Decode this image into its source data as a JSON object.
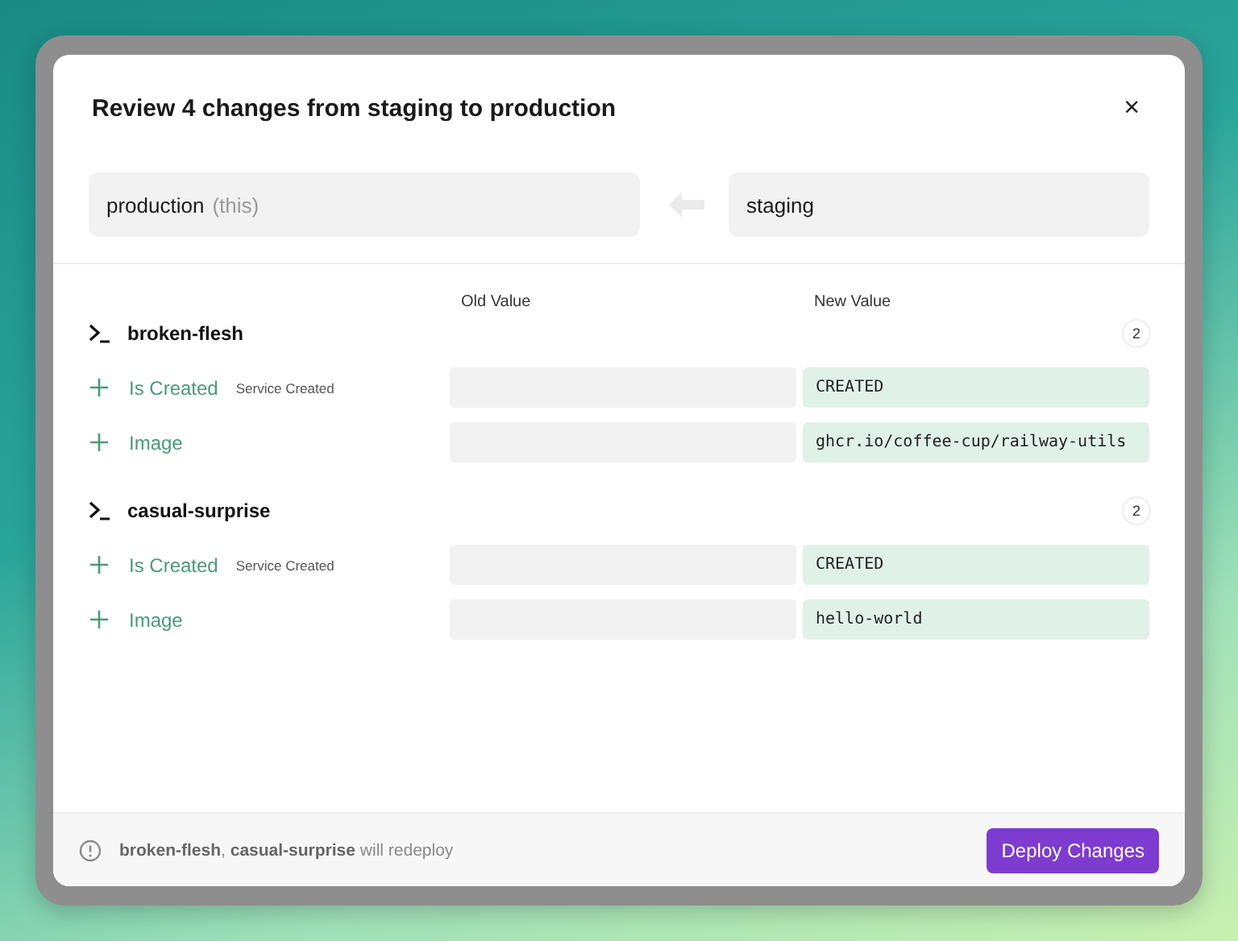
{
  "dialog": {
    "title": "Review 4 changes from staging to production",
    "close": "×"
  },
  "source_env": {
    "name": "production",
    "note": "(this)"
  },
  "target_env": {
    "name": "staging"
  },
  "columns": [
    "Old Value",
    "New Value"
  ],
  "services": [
    {
      "name": "broken-flesh",
      "count": "2",
      "changes": [
        {
          "label": "Is Created",
          "note": "Service Created",
          "new_value": "CREATED"
        },
        {
          "label": "Image",
          "new_value": "ghcr.io/coffee-cup/railway-utils"
        }
      ]
    },
    {
      "name": "casual-surprise",
      "count": "2",
      "changes": [
        {
          "label": "Is Created",
          "note": "Service Created",
          "new_value": "CREATED"
        },
        {
          "label": "Image",
          "new_value": "hello-world"
        }
      ]
    }
  ],
  "footer": {
    "message": "**broken-flesh**, **casual-surprise** will redeploy",
    "button": "Deploy Changes"
  }
}
